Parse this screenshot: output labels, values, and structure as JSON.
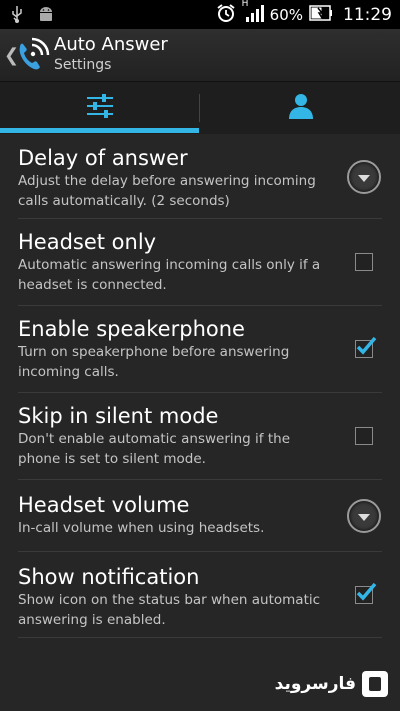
{
  "status_bar": {
    "battery_percent": "60%",
    "time": "11:29",
    "network_label": "H",
    "icons": [
      "usb-icon",
      "android-icon",
      "alarm-clock-icon",
      "signal-icon",
      "battery-charging-icon"
    ]
  },
  "action_bar": {
    "title": "Auto Answer",
    "subtitle": "Settings",
    "logo_icon": "phone-wifi-icon"
  },
  "tabs": [
    {
      "name": "settings",
      "icon": "sliders-icon",
      "selected": true
    },
    {
      "name": "profile",
      "icon": "person-icon",
      "selected": false
    }
  ],
  "accent_color": "#33b5e5",
  "settings": [
    {
      "title": "Delay of answer",
      "summary": "Adjust the delay before answering incoming calls automatically. (2 seconds)",
      "control": "dropdown"
    },
    {
      "title": "Headset only",
      "summary": "Automatic answering incoming calls only if a headset is connected.",
      "control": "checkbox",
      "checked": false
    },
    {
      "title": "Enable speakerphone",
      "summary": "Turn on speakerphone before answering incoming calls.",
      "control": "checkbox",
      "checked": true
    },
    {
      "title": "Skip in silent mode",
      "summary": "Don't enable automatic answering if the phone is set to silent mode.",
      "control": "checkbox",
      "checked": false
    },
    {
      "title": "Headset volume",
      "summary": "In-call volume when using headsets.",
      "control": "dropdown"
    },
    {
      "title": "Show notification",
      "summary": "Show icon on the status bar when automatic answering is enabled.",
      "control": "checkbox",
      "checked": true
    }
  ],
  "watermark": {
    "text": "فارسروید"
  }
}
